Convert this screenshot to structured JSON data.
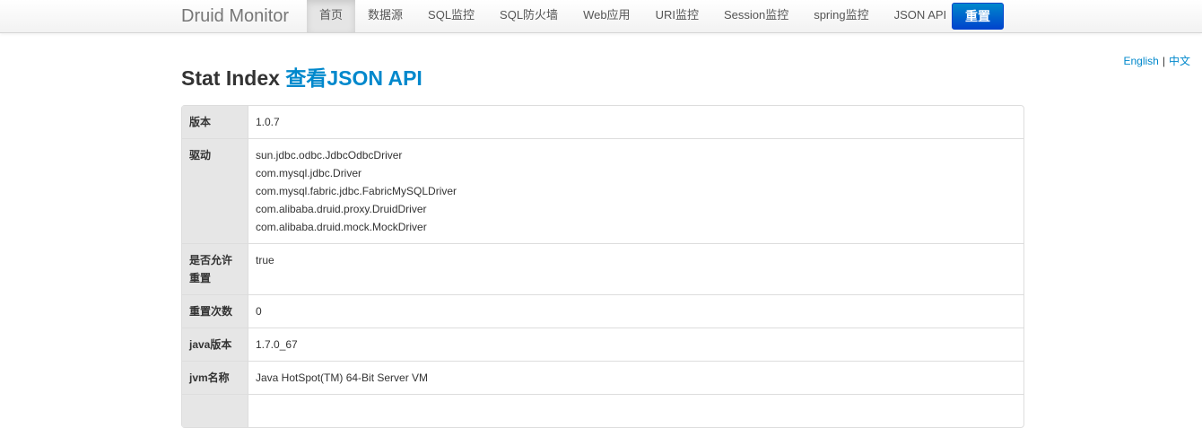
{
  "navbar": {
    "brand": "Druid Monitor",
    "items": [
      {
        "label": "首页",
        "active": true
      },
      {
        "label": "数据源",
        "active": false
      },
      {
        "label": "SQL监控",
        "active": false
      },
      {
        "label": "SQL防火墙",
        "active": false
      },
      {
        "label": "Web应用",
        "active": false
      },
      {
        "label": "URI监控",
        "active": false
      },
      {
        "label": "Session监控",
        "active": false
      },
      {
        "label": "spring监控",
        "active": false
      },
      {
        "label": "JSON API",
        "active": false
      }
    ],
    "reset_label": "重置"
  },
  "lang": {
    "english": "English",
    "separator": "|",
    "chinese": "中文"
  },
  "page": {
    "title": "Stat Index",
    "json_link": "查看JSON API"
  },
  "table": {
    "version_label": "版本",
    "version_value": "1.0.7",
    "drivers_label": "驱动",
    "drivers": [
      "sun.jdbc.odbc.JdbcOdbcDriver",
      "com.mysql.jdbc.Driver",
      "com.mysql.fabric.jdbc.FabricMySQLDriver",
      "com.alibaba.druid.proxy.DruidDriver",
      "com.alibaba.druid.mock.MockDriver"
    ],
    "reset_enable_label": "是否允许重置",
    "reset_enable_value": "true",
    "reset_count_label": "重置次数",
    "reset_count_value": "0",
    "java_version_label": "java版本",
    "java_version_value": "1.7.0_67",
    "jvm_name_label": "jvm名称",
    "jvm_name_value": "Java HotSpot(TM) 64-Bit Server VM"
  },
  "colors": {
    "link": "#0088cc",
    "button": "#0044cc",
    "label_bg": "#e6e6e6"
  }
}
